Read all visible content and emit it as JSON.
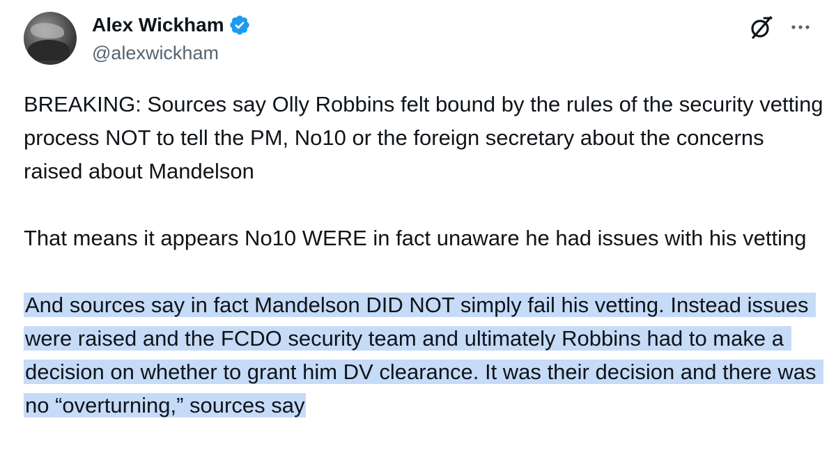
{
  "author": {
    "display_name": "Alex Wickham",
    "handle": "@alexwickham",
    "verified": true,
    "verified_icon": "verified-badge-icon",
    "avatar_icon": "avatar"
  },
  "actions": {
    "grok_icon": "grok-icon",
    "more_icon": "more-options-icon"
  },
  "colors": {
    "text": "#0f1419",
    "secondary": "#536471",
    "verified_blue": "#1d9bf0",
    "highlight": "#c6dbf7"
  },
  "tweet": {
    "paragraph_1": "BREAKING: Sources say Olly Robbins felt bound by the rules of the security vetting process NOT to tell the PM, No10 or the foreign secretary about the concerns raised about Mandelson",
    "paragraph_2": "That means it appears No10 WERE in fact unaware he had issues with his vetting",
    "paragraph_3": "And sources say in fact Mandelson DID NOT simply fail his vetting. Instead issues were raised and the FCDO security team and ultimately Robbins had to make a decision on whether to grant him DV clearance. It was their decision and there was no “overturning,” sources say"
  }
}
